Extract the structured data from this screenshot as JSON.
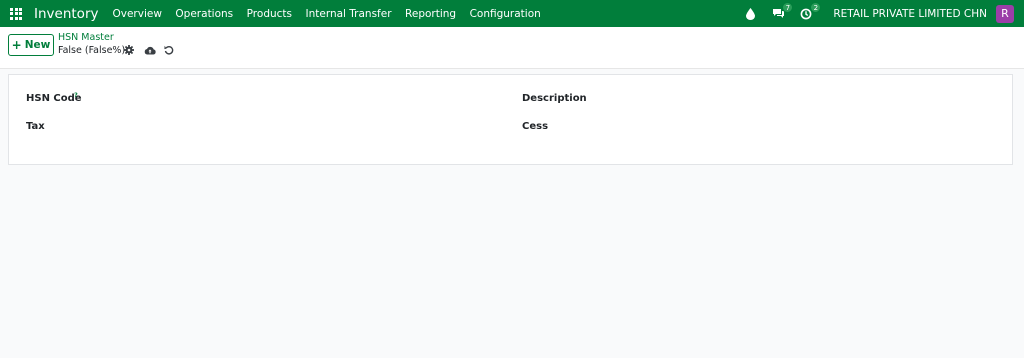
{
  "navbar": {
    "app_name": "Inventory",
    "menu": [
      "Overview",
      "Operations",
      "Products",
      "Internal Transfer",
      "Reporting",
      "Configuration"
    ],
    "messages_count": "7",
    "activities_count": "2",
    "company": "RETAIL PRIVATE LIMITED CHN",
    "avatar_initial": "R",
    "avatar_color": "#9b3ea8",
    "brand_color": "#017e3b"
  },
  "control_panel": {
    "new_label": "New",
    "breadcrumb": "HSN Master",
    "record_name": "False (False%)"
  },
  "form": {
    "hsn_code_label": "HSN Code",
    "help_mark": "?",
    "description_label": "Description",
    "tax_label": "Tax",
    "cess_label": "Cess"
  }
}
